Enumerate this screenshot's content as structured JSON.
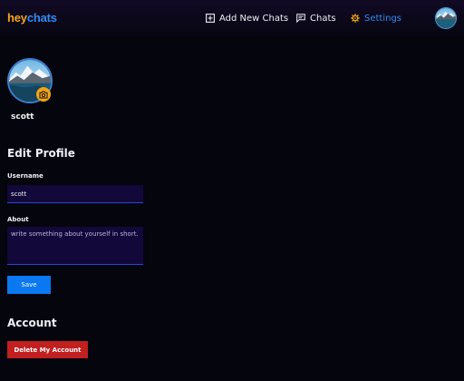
{
  "brand": {
    "part1": "hey",
    "part2": "chats"
  },
  "nav": {
    "add_new_chats": "Add New Chats",
    "chats": "Chats",
    "settings": "Settings"
  },
  "profile": {
    "name": "scott"
  },
  "edit_profile": {
    "title": "Edit Profile",
    "username_label": "Username",
    "username_value": "scott",
    "about_label": "About",
    "about_placeholder": "write something about yourself in short.",
    "save_label": "Save"
  },
  "account": {
    "title": "Account",
    "delete_label": "Delete My Account"
  },
  "colors": {
    "background": "#04050d",
    "brand_orange": "#f4a51c",
    "brand_blue": "#2f8bf4",
    "save_button": "#0a78f0",
    "delete_button": "#c11f20",
    "input_bg": "#13083a",
    "camera_badge": "#f2a516"
  },
  "icons": {
    "add": "plus-square-icon",
    "chats": "message-icon",
    "settings": "gear-icon",
    "camera": "camera-icon"
  }
}
